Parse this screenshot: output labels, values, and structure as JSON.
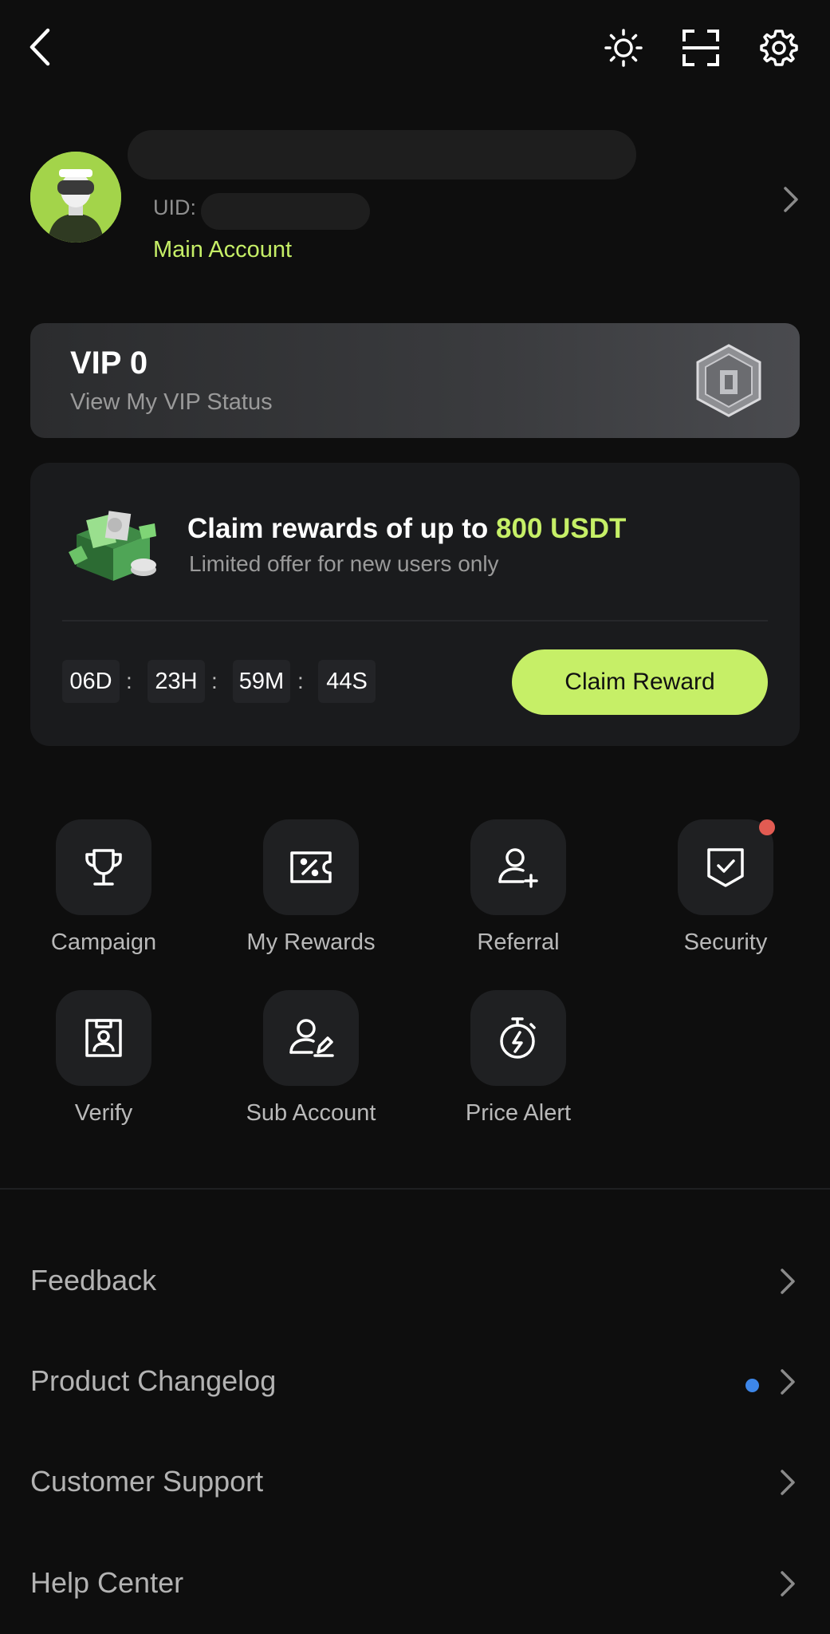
{
  "profile": {
    "uid_label": "UID:",
    "account_type": "Main Account"
  },
  "vip": {
    "title": "VIP 0",
    "subtitle": "View My VIP Status"
  },
  "reward": {
    "title_prefix": "Claim rewards of up to",
    "title_highlight": "800 USDT",
    "subtitle": "Limited offer for new users only",
    "countdown": {
      "days": "06D",
      "hours": "23H",
      "minutes": "59M",
      "seconds": "44S"
    },
    "separator": ":",
    "button": "Claim Reward"
  },
  "shortcuts": [
    {
      "label": "Campaign",
      "icon": "trophy-icon"
    },
    {
      "label": "My Rewards",
      "icon": "coupon-icon"
    },
    {
      "label": "Referral",
      "icon": "user-add-icon"
    },
    {
      "label": "Security",
      "icon": "shield-check-icon",
      "badge": true
    },
    {
      "label": "Verify",
      "icon": "id-card-icon"
    },
    {
      "label": "Sub Account",
      "icon": "user-edit-icon"
    },
    {
      "label": "Price Alert",
      "icon": "stopwatch-icon"
    }
  ],
  "menu": [
    {
      "label": "Feedback"
    },
    {
      "label": "Product Changelog",
      "dot": true
    },
    {
      "label": "Customer Support"
    },
    {
      "label": "Help Center"
    }
  ],
  "colors": {
    "accent": "#c6ef67",
    "background": "#0e0e0e",
    "alert_dot": "#e25b52",
    "info_dot": "#3d86e8"
  }
}
